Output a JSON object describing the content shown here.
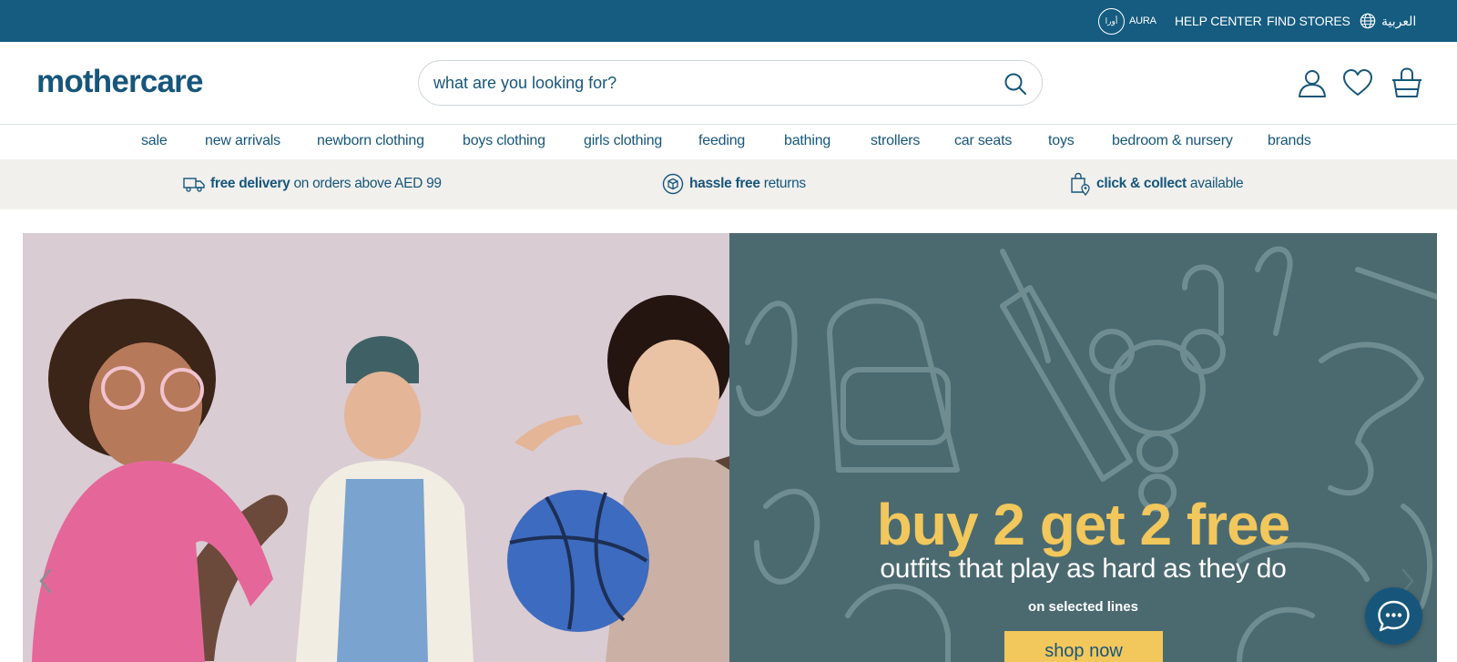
{
  "topbar": {
    "aura_badge": "أورا",
    "aura_label": "AURA",
    "help_center": "HELP CENTER",
    "find_stores": "FIND STORES",
    "language": "العربية"
  },
  "header": {
    "logo": "mothercare",
    "search_placeholder": "what are you looking for?",
    "icons": [
      "search-icon",
      "account-icon",
      "wishlist-icon",
      "basket-icon"
    ]
  },
  "nav": {
    "items": [
      "sale",
      "new arrivals",
      "newborn clothing",
      "boys clothing",
      "girls clothing",
      "feeding",
      "bathing",
      "strollers",
      "car seats",
      "toys",
      "bedroom & nursery",
      "brands"
    ]
  },
  "perks": {
    "delivery_bold": "free delivery",
    "delivery_rest": "on orders above AED 99",
    "returns_bold": "hassle free",
    "returns_rest": "returns",
    "collect_bold": "click & collect",
    "collect_rest": "available"
  },
  "hero": {
    "title": "buy 2 get 2 free",
    "subtitle": "outfits that play as hard as they do",
    "note": "on selected lines",
    "cta": "shop now"
  },
  "colors": {
    "brand_blue": "#155c80",
    "text_blue": "#17567a",
    "promo_teal": "#4b6a70",
    "promo_yellow": "#f2c75c",
    "perk_bg": "#f1f0ed"
  }
}
